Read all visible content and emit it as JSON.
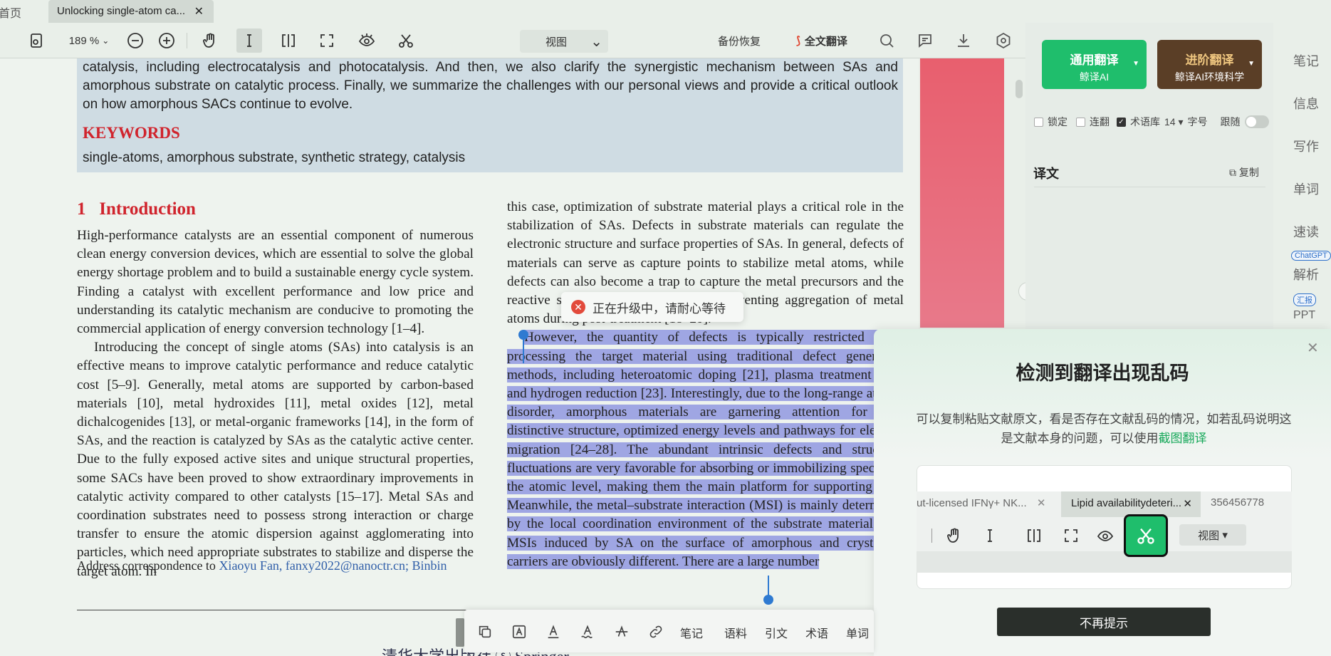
{
  "tabs": {
    "home": "首页",
    "doc": "Unlocking single-atom ca...",
    "close": "✕"
  },
  "toolbar": {
    "zoom": "189 %",
    "view": "视图",
    "backup": "备份恢复",
    "fulltext": "全文翻译"
  },
  "document": {
    "abstract": "catalysis, including electrocatalysis and photocatalysis. And then, we also clarify the synergistic mechanism between SAs and amorphous substrate on catalytic process. Finally, we summarize the challenges with our personal views and provide a critical outlook on how amorphous SACs continue to evolve.",
    "keywords_heading": "KEYWORDS",
    "keywords": "single-atoms, amorphous substrate, synthetic strategy, catalysis",
    "section_num": "1",
    "section_title": "Introduction",
    "left_p1": "High-performance catalysts are an essential component of numerous clean energy conversion devices, which are essential to solve the global energy shortage problem and to build a sustainable energy cycle system. Finding a catalyst with excellent performance and low price and understanding its catalytic mechanism are conducive to promoting the commercial application of energy conversion technology [1–4].",
    "left_p2": "Introducing the concept of single atoms (SAs) into catalysis is an effective means to improve catalytic performance and reduce catalytic cost [5–9]. Generally, metal atoms are supported by carbon-based materials [10], metal hydroxides [11], metal oxides [12], metal dichalcogenides [13], or metal-organic frameworks [14], in the form of SAs, and the reaction is catalyzed by SAs as the catalytic active center. Due to the fully exposed active sites and unique structural properties, some SACs have been proved to show extraordinary improvements in catalytic activity compared to other catalysts [15–17]. Metal SAs and coordination substrates need to possess strong interaction or charge transfer to ensure the atomic dispersion against agglomerating into particles, which need appropriate substrates to stabilize and disperse the target atom. In",
    "right_p1": "this case, optimization of substrate material plays a critical role in the stabilization of SAs. Defects in substrate materials can regulate the electronic structure and surface properties of SAs. In general, defects of materials can serve as capture points to stabilize metal atoms, while defects can also become a trap to capture the metal precursors and the reactive species on the surface, and preventing aggregation of metal atoms during post-treatment [18–20].",
    "right_p2": "However, the quantity of defects is typically restricted when processing the target material using traditional defect generation methods, including heteroatomic doping [21], plasma treatment [22], and hydrogen reduction [23]. Interestingly, due to the long-range atomic disorder, amorphous materials are garnering attention for their distinctive structure, optimized energy levels and pathways for electron migration [24–28]. The abundant intrinsic defects and structural fluctuations are very favorable for absorbing or immobilizing species at the atomic level, making them the main platform for supporting SAs. Meanwhile, the metal–substrate interaction (MSI) is mainly determined by the local coordination environment of the substrate material. The MSIs induced by SA on the surface of amorphous and crystalline carriers are obviously different. There are a large number",
    "footer_prefix": "Address correspondence to",
    "footer_link": "Xiaoyu Fan, fanxy2022@nanoctr.cn; Binbin",
    "publisher": "清华大学出版社 ⓢ Springer"
  },
  "toast": {
    "text": "正在升级中，请耐心等待"
  },
  "translate_panel": {
    "general_main": "通用翻译",
    "general_sub": "鲸译AI",
    "adv_main": "进阶翻译",
    "adv_sub": "鲸译AI环境科学",
    "opt_lock": "锁定",
    "opt_continuous": "连翻",
    "opt_termbase": "术语库",
    "font_size": "14",
    "font_label": "字号",
    "follow": "跟随",
    "yiwen": "译文",
    "copy": "复制"
  },
  "rail": {
    "notes": "笔记",
    "info": "信息",
    "write": "写作",
    "words": "单词",
    "speed": "速读",
    "chatgpt_badge": "ChatGPT",
    "analyze": "解析",
    "report_badge": "汇报",
    "ppt": "PPT"
  },
  "popup": {
    "title": "检测到翻译出现乱码",
    "desc": "可以复制粘贴文献原文，看是否存在文献乱码的情况，如若乱码说明这是文献本身的问题，可以使用",
    "link": "截图翻译",
    "tab1": "ut-licensed IFNγ+ NK...",
    "tab2": "Lipid availabilitydeteri...",
    "tab3": "356456778",
    "view": "视图",
    "never": "不再提示"
  },
  "seltool": {
    "notes": "笔记",
    "corpus": "语料",
    "cite": "引文",
    "term": "术语",
    "word": "单词"
  },
  "colors": {
    "accent_green": "#1fbe6c",
    "selection": "#9fa6e3",
    "heading_red": "#d0242d"
  }
}
